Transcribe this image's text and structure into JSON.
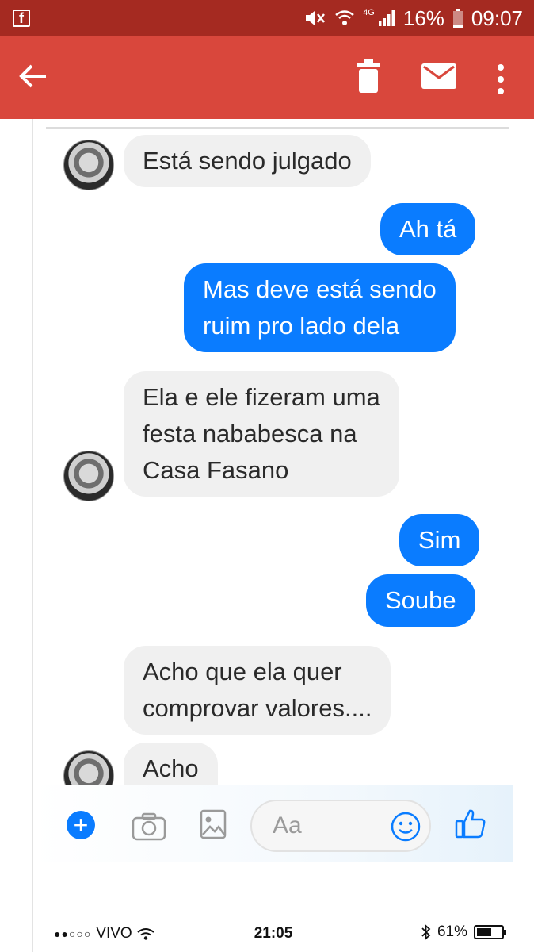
{
  "android_status": {
    "app_icon": "f",
    "network": "4G",
    "battery": "16%",
    "time": "09:07",
    "icons": [
      "facebook-icon",
      "mute-icon",
      "wifi-icon",
      "signal-icon",
      "battery-icon"
    ]
  },
  "toolbar": {
    "icons": [
      "back-arrow-icon",
      "trash-icon",
      "mail-icon",
      "more-vert-icon"
    ],
    "color": "#d9473c",
    "status_color": "#a52a21"
  },
  "messages": [
    {
      "side": "in",
      "text": "Está sendo julgado"
    },
    {
      "side": "out",
      "text": "Ah tá"
    },
    {
      "side": "out",
      "text": "Mas deve está sendo\nruim pro lado dela"
    },
    {
      "side": "in",
      "text": "Ela e ele fizeram uma\nfesta nababesca na\nCasa Fasano"
    },
    {
      "side": "out",
      "text": "Sim"
    },
    {
      "side": "out",
      "text": "Soube"
    },
    {
      "side": "in",
      "text": "Acho que ela quer\ncomprovar valores...."
    },
    {
      "side": "in",
      "text": "Acho"
    }
  ],
  "composer": {
    "placeholder": "Aa",
    "icons": [
      "plus-icon",
      "camera-icon",
      "image-icon",
      "smiley-icon",
      "thumbs-up-icon"
    ],
    "accent": "#0a7cff"
  },
  "ios_status": {
    "carrier": "VIVO",
    "signal_dots": "●●○○○",
    "time": "21:05",
    "battery": "61%",
    "battery_level": 0.61
  }
}
